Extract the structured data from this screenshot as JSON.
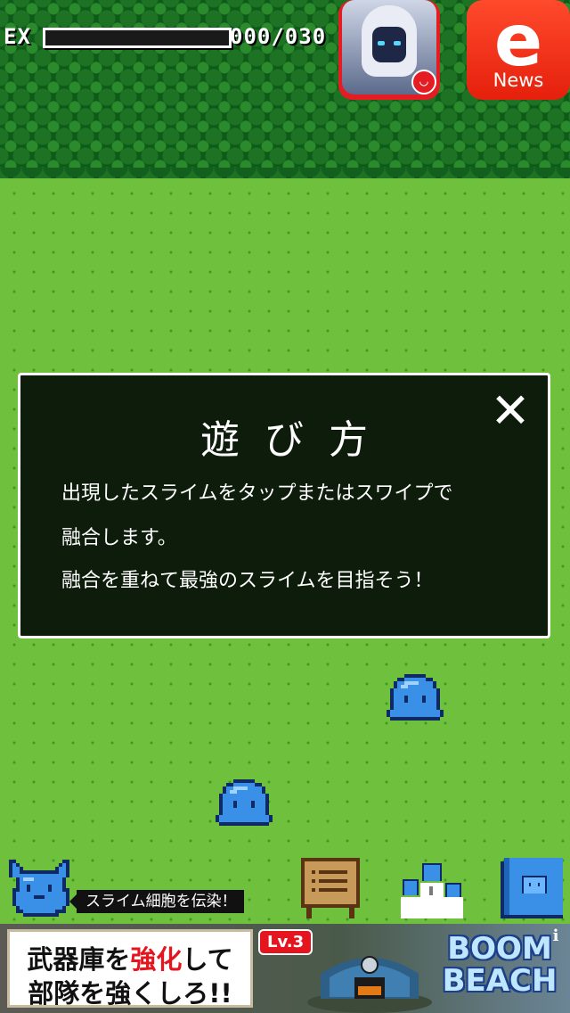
{
  "hud": {
    "ex_label": "EX",
    "ex_progress": 0.0,
    "ex_count": "000/030"
  },
  "promo": {
    "icon": "character-portrait-icon"
  },
  "news": {
    "letter": "e",
    "label": "News"
  },
  "dialog": {
    "title": "遊び方",
    "lines": [
      "出現したスライムをタップまたはスワイプで",
      "融合します。",
      "融合を重ねて最強のスライムを目指そう！"
    ],
    "close_icon": "close-icon"
  },
  "field": {
    "slimes": 2
  },
  "toolbar": {
    "infect_label": "スライム細胞を伝染！",
    "icons": [
      "mascot-icon",
      "notice-board-icon",
      "ranking-podium-icon",
      "slime-book-icon"
    ]
  },
  "ad": {
    "line1_a": "武器庫を",
    "line1_red": "強化",
    "line1_b": "して",
    "line2": "部隊を強くしろ!!",
    "level": "Lv.3",
    "logo": "BOOM BEACH",
    "info": "i"
  },
  "colors": {
    "grass": "#6fc13d",
    "forest": "#0e5a19",
    "dialog_bg": "#0e1c0b",
    "slime": "#3a8fe6",
    "news_red": "#e5200c"
  }
}
